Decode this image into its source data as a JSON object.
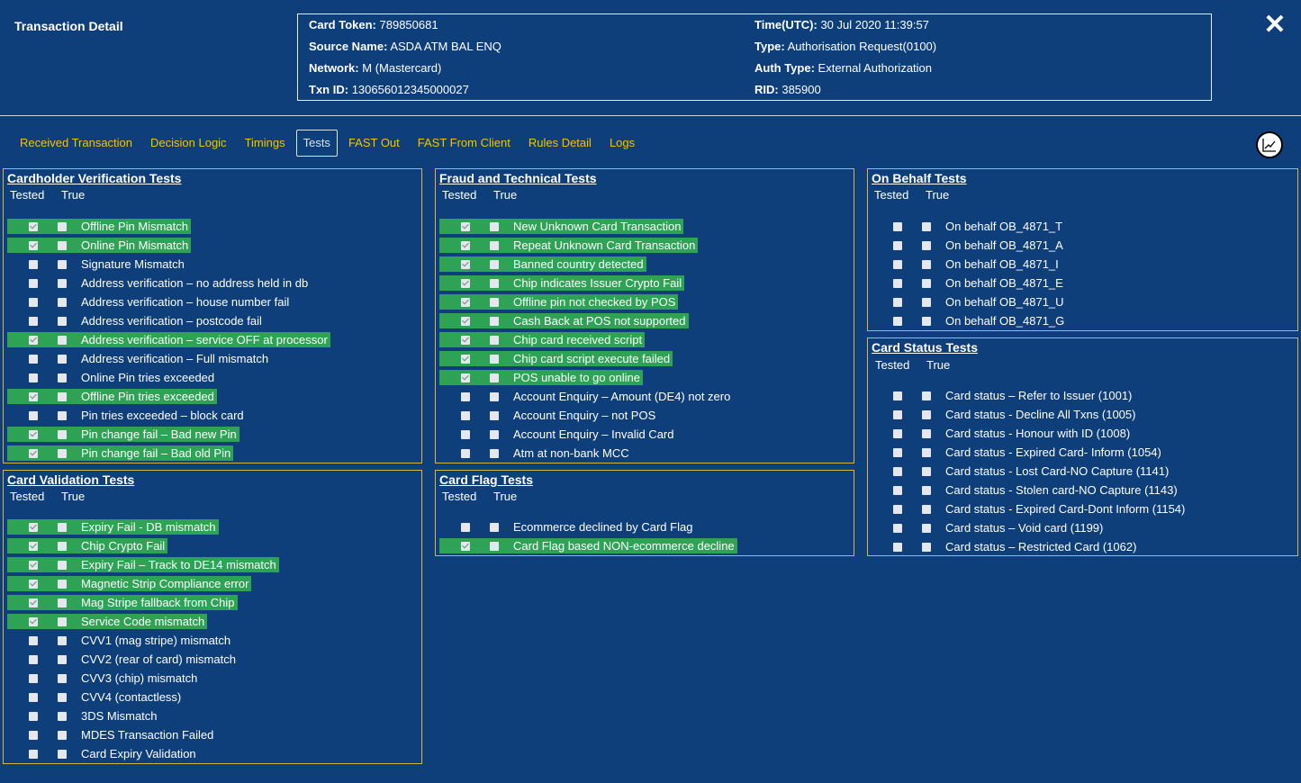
{
  "header": {
    "title": "Transaction Detail",
    "close_label": "✕"
  },
  "info": {
    "left": [
      {
        "k": "Card Token:",
        "v": "789850681"
      },
      {
        "k": "Source Name:",
        "v": "ASDA ATM BAL ENQ"
      },
      {
        "k": "Network:",
        "v": "M (Mastercard)"
      },
      {
        "k": "Txn ID:",
        "v": "130656012345000027"
      }
    ],
    "right": [
      {
        "k": "Time(UTC):",
        "v": "30 Jul 2020 11:39:57"
      },
      {
        "k": "Type:",
        "v": "Authorisation Request(0100)"
      },
      {
        "k": "Auth Type:",
        "v": "External Authorization"
      },
      {
        "k": "RID:",
        "v": "385900"
      }
    ]
  },
  "tabs": [
    {
      "label": "Received Transaction",
      "active": false
    },
    {
      "label": "Decision Logic",
      "active": false
    },
    {
      "label": "Timings",
      "active": false
    },
    {
      "label": "Tests",
      "active": true
    },
    {
      "label": "FAST Out",
      "active": false
    },
    {
      "label": "FAST From Client",
      "active": false
    },
    {
      "label": "Rules Detail",
      "active": false
    },
    {
      "label": "Logs",
      "active": false
    }
  ],
  "col_tested": "Tested",
  "col_true": "True",
  "colors": {
    "highlight": "#2ea356",
    "background": "#0f3f7a",
    "tab": "#f5c400",
    "border": "#d3b54a"
  },
  "panels": {
    "cardholder": {
      "title": "Cardholder Verification Tests",
      "rows": [
        {
          "label": "Offline Pin Mismatch",
          "tested": true,
          "true": false
        },
        {
          "label": "Online Pin Mismatch",
          "tested": true,
          "true": false
        },
        {
          "label": "Signature Mismatch",
          "tested": false,
          "true": false
        },
        {
          "label": "Address verification – no address held in db",
          "tested": false,
          "true": false
        },
        {
          "label": "Address verification – house number fail",
          "tested": false,
          "true": false
        },
        {
          "label": "Address verification – postcode fail",
          "tested": false,
          "true": false
        },
        {
          "label": "Address verification – service OFF at processor",
          "tested": true,
          "true": false
        },
        {
          "label": "Address verification – Full mismatch",
          "tested": false,
          "true": false
        },
        {
          "label": "Online Pin tries exceeded",
          "tested": false,
          "true": false
        },
        {
          "label": "Offline Pin tries exceeded",
          "tested": true,
          "true": false
        },
        {
          "label": "Pin tries exceeded – block card",
          "tested": false,
          "true": false
        },
        {
          "label": "Pin change fail – Bad new Pin",
          "tested": true,
          "true": false
        },
        {
          "label": "Pin change fail – Bad old Pin",
          "tested": true,
          "true": false
        }
      ]
    },
    "fraud": {
      "title": "Fraud and Technical Tests",
      "rows": [
        {
          "label": "New Unknown Card Transaction",
          "tested": true,
          "true": false
        },
        {
          "label": "Repeat Unknown Card Transaction",
          "tested": true,
          "true": false
        },
        {
          "label": "Banned country detected",
          "tested": true,
          "true": false
        },
        {
          "label": "Chip indicates Issuer Crypto Fail",
          "tested": true,
          "true": false
        },
        {
          "label": "Offline pin not checked by POS",
          "tested": true,
          "true": false
        },
        {
          "label": "Cash Back at POS not supported",
          "tested": true,
          "true": false
        },
        {
          "label": "Chip card received script",
          "tested": true,
          "true": false
        },
        {
          "label": "Chip card script execute failed",
          "tested": true,
          "true": false
        },
        {
          "label": "POS unable to go online",
          "tested": true,
          "true": false
        },
        {
          "label": "Account Enquiry – Amount (DE4) not zero",
          "tested": false,
          "true": false
        },
        {
          "label": "Account Enquiry – not POS",
          "tested": false,
          "true": false
        },
        {
          "label": "Account Enquiry – Invalid Card",
          "tested": false,
          "true": false
        },
        {
          "label": "Atm at non-bank MCC",
          "tested": false,
          "true": false
        }
      ]
    },
    "behalf": {
      "title": "On Behalf Tests",
      "rows": [
        {
          "label": "On behalf OB_4871_T",
          "tested": false,
          "true": false
        },
        {
          "label": "On behalf OB_4871_A",
          "tested": false,
          "true": false
        },
        {
          "label": "On behalf OB_4871_I",
          "tested": false,
          "true": false
        },
        {
          "label": "On behalf OB_4871_E",
          "tested": false,
          "true": false
        },
        {
          "label": "On behalf OB_4871_U",
          "tested": false,
          "true": false
        },
        {
          "label": "On behalf OB_4871_G",
          "tested": false,
          "true": false
        }
      ]
    },
    "status": {
      "title": "Card Status Tests",
      "rows": [
        {
          "label": "Card status – Refer to Issuer (1001)",
          "tested": false,
          "true": false
        },
        {
          "label": "Card status - Decline All Txns (1005)",
          "tested": false,
          "true": false
        },
        {
          "label": "Card status - Honour with ID (1008)",
          "tested": false,
          "true": false
        },
        {
          "label": "Card status - Expired Card- Inform (1054)",
          "tested": false,
          "true": false
        },
        {
          "label": "Card status - Lost Card-NO Capture (1141)",
          "tested": false,
          "true": false
        },
        {
          "label": "Card status - Stolen card-NO Capture (1143)",
          "tested": false,
          "true": false
        },
        {
          "label": "Card status - Expired Card-Dont Inform (1154)",
          "tested": false,
          "true": false
        },
        {
          "label": "Card status – Void card (1199)",
          "tested": false,
          "true": false
        },
        {
          "label": "Card status – Restricted Card (1062)",
          "tested": false,
          "true": false
        }
      ]
    },
    "validation": {
      "title": "Card Validation Tests",
      "rows": [
        {
          "label": "Expiry Fail - DB mismatch",
          "tested": true,
          "true": false
        },
        {
          "label": "Chip Crypto Fail",
          "tested": true,
          "true": false
        },
        {
          "label": "Expiry Fail – Track to DE14 mismatch",
          "tested": true,
          "true": false
        },
        {
          "label": "Magnetic Strip Compliance error",
          "tested": true,
          "true": false
        },
        {
          "label": "Mag Stripe fallback from Chip",
          "tested": true,
          "true": false
        },
        {
          "label": "Service Code mismatch",
          "tested": true,
          "true": false
        },
        {
          "label": "CVV1 (mag stripe) mismatch",
          "tested": false,
          "true": false
        },
        {
          "label": "CVV2 (rear of card) mismatch",
          "tested": false,
          "true": false
        },
        {
          "label": "CVV3 (chip) mismatch",
          "tested": false,
          "true": false
        },
        {
          "label": "CVV4 (contactless)",
          "tested": false,
          "true": false
        },
        {
          "label": "3DS Mismatch",
          "tested": false,
          "true": false
        },
        {
          "label": "MDES Transaction Failed",
          "tested": false,
          "true": false
        },
        {
          "label": "Card Expiry Validation",
          "tested": false,
          "true": false
        }
      ]
    },
    "flag": {
      "title": "Card Flag Tests",
      "rows": [
        {
          "label": "Ecommerce declined by Card Flag",
          "tested": false,
          "true": false
        },
        {
          "label": "Card Flag based NON-ecommerce decline",
          "tested": true,
          "true": false
        }
      ]
    }
  }
}
